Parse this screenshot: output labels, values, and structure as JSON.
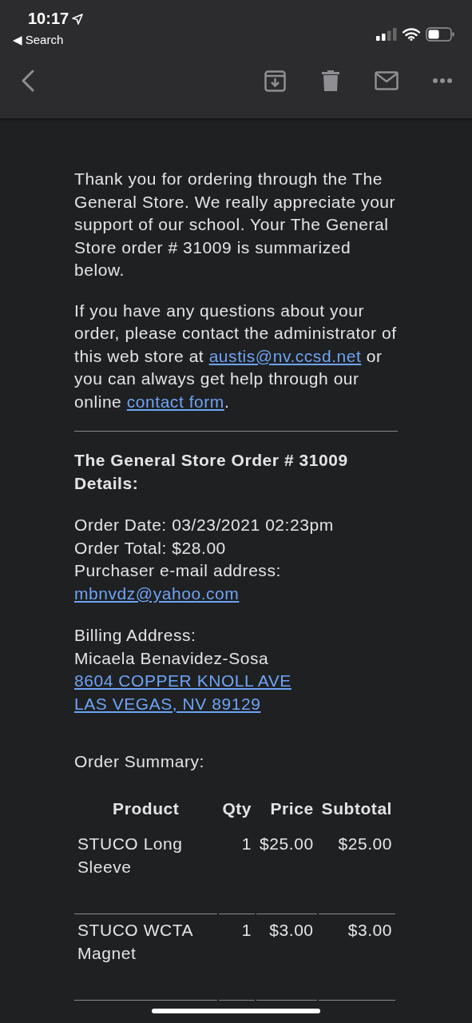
{
  "status_bar": {
    "time": "10:17",
    "back_label": "◀ Search"
  },
  "intro": "Thank you for ordering through the The General Store. We really appreciate your support of our school. Your The General Store order # 31009  is summarized below.",
  "contact": [
    {
      "kind": "text",
      "text": "If you have any questions about your order, please contact the administrator of this web store at "
    },
    {
      "kind": "link",
      "text": "austis@nv.ccsd.net"
    },
    {
      "kind": "text",
      "text": " or you can always get help through our online "
    },
    {
      "kind": "link",
      "text": "contact form"
    },
    {
      "kind": "text",
      "text": "."
    }
  ],
  "details": {
    "heading": "The General Store Order # 31009 Details:",
    "lines": [
      {
        "kind": "text",
        "text": "Order Date: 03/23/2021 02:23pm"
      },
      {
        "kind": "text",
        "text": "Order Total: $28.00"
      },
      {
        "kind": "text",
        "text": "Purchaser e-mail address:"
      },
      {
        "kind": "link",
        "text": "mbnvdz@yahoo.com"
      }
    ]
  },
  "billing": [
    {
      "kind": "text",
      "text": "Billing Address:"
    },
    {
      "kind": "text",
      "text": "Micaela Benavidez-Sosa"
    },
    {
      "kind": "link",
      "text": "8604 COPPER KNOLL AVE"
    },
    {
      "kind": "link",
      "text": "LAS VEGAS, NV 89129"
    }
  ],
  "summary_label": "Order Summary:",
  "table": {
    "columns": [
      "Product",
      "Qty",
      "Price",
      "Subtotal"
    ],
    "rows": [
      [
        "STUCO Long Sleeve",
        "1",
        "$25.00",
        "$25.00"
      ],
      [
        "STUCO WCTA Magnet",
        "1",
        "$3.00",
        "$3.00"
      ]
    ]
  }
}
